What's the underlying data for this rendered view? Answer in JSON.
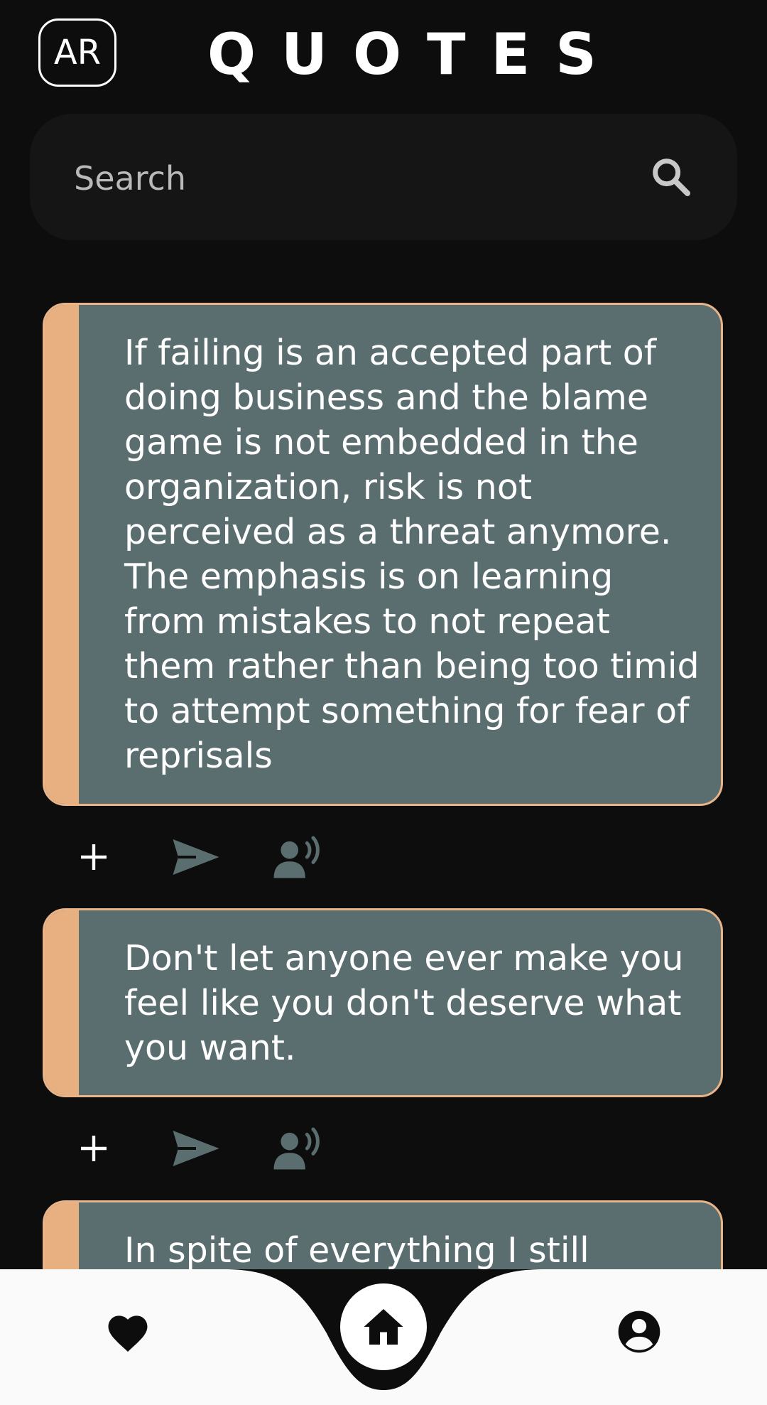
{
  "header": {
    "avatar_initials": "AR",
    "title": "QUOTES"
  },
  "search": {
    "placeholder": "Search",
    "value": ""
  },
  "quotes": [
    {
      "text": "If failing is an accepted part of doing business and the blame game is not embedded in the organization, risk is not perceived as a threat anymore. The emphasis is on learning from mistakes to not repeat them rather than being too timid to attempt something for fear of reprisals"
    },
    {
      "text": "Don't let anyone ever make you feel like you don't deserve what you want."
    },
    {
      "text": "In spite of everything I still"
    }
  ],
  "actions": {
    "add_icon": "plus-icon",
    "share_icon": "send-icon",
    "speak_icon": "record-voice-icon"
  },
  "nav": {
    "favorites_icon": "heart-icon",
    "home_icon": "home-icon",
    "profile_icon": "account-circle-icon"
  },
  "colors": {
    "background": "#0d0d0d",
    "card": "#5a6e70",
    "accent": "#e8b080",
    "nav_bg": "#fafafa"
  }
}
